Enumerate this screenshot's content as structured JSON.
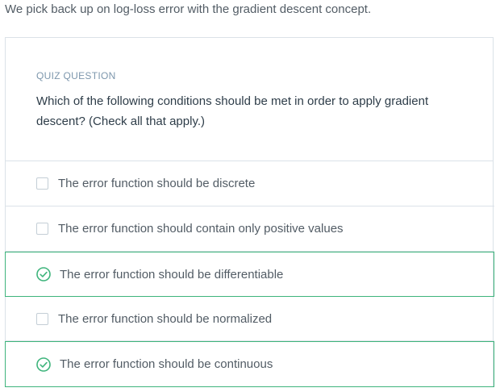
{
  "intro_text": "We pick back up on log-loss error with the gradient descent concept.",
  "quiz": {
    "label": "QUIZ QUESTION",
    "question": "Which of the following conditions should be met in order to apply gradient descent? (Check all that apply.)",
    "options": [
      {
        "label": "The error function should be discrete",
        "checked": false
      },
      {
        "label": "The error function should contain only positive values",
        "checked": false
      },
      {
        "label": "The error function should be differentiable",
        "checked": true
      },
      {
        "label": "The error function should be normalized",
        "checked": false
      },
      {
        "label": "The error function should be continuous",
        "checked": true
      }
    ]
  },
  "colors": {
    "correct_accent": "#3eb47c",
    "border": "#dbe2e8",
    "label": "#7d97ad"
  },
  "icons": {
    "checked": "check-circle-icon",
    "unchecked": "checkbox-icon"
  }
}
